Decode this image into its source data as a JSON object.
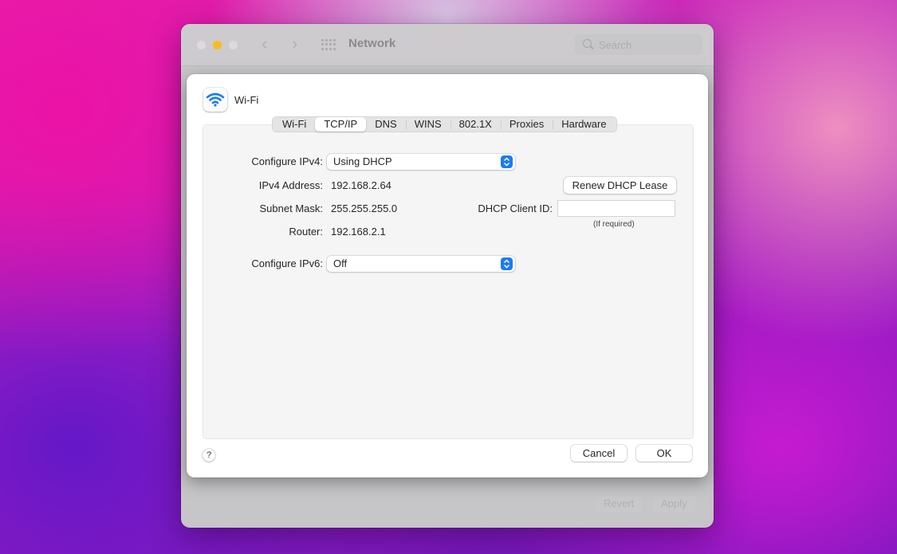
{
  "window": {
    "title": "Network",
    "search_placeholder": "Search",
    "nav": {
      "back": "‹",
      "forward": "›"
    },
    "bottom_buttons": {
      "revert": "Revert",
      "apply": "Apply"
    }
  },
  "sheet": {
    "service": {
      "name": "Wi-Fi",
      "icon": "wifi-icon",
      "icon_color": "#1a7cf5"
    },
    "tabs": [
      {
        "label": "Wi-Fi",
        "active": false
      },
      {
        "label": "TCP/IP",
        "active": true
      },
      {
        "label": "DNS",
        "active": false
      },
      {
        "label": "WINS",
        "active": false
      },
      {
        "label": "802.1X",
        "active": false
      },
      {
        "label": "Proxies",
        "active": false
      },
      {
        "label": "Hardware",
        "active": false
      }
    ],
    "tcpip": {
      "configure_ipv4": {
        "label": "Configure IPv4:",
        "value": "Using DHCP"
      },
      "ipv4_address": {
        "label": "IPv4 Address:",
        "value": "192.168.2.64"
      },
      "subnet_mask": {
        "label": "Subnet Mask:",
        "value": "255.255.255.0"
      },
      "router": {
        "label": "Router:",
        "value": "192.168.2.1"
      },
      "renew_button": "Renew DHCP Lease",
      "dhcp_client_id": {
        "label": "DHCP Client ID:",
        "value": "",
        "hint": "(If required)"
      },
      "configure_ipv6": {
        "label": "Configure IPv6:",
        "value": "Off"
      }
    },
    "footer": {
      "help": "?",
      "cancel": "Cancel",
      "ok": "OK"
    }
  },
  "colors": {
    "accent": "#1a7cf5",
    "traffic_minimize": "#f6bd1c"
  }
}
